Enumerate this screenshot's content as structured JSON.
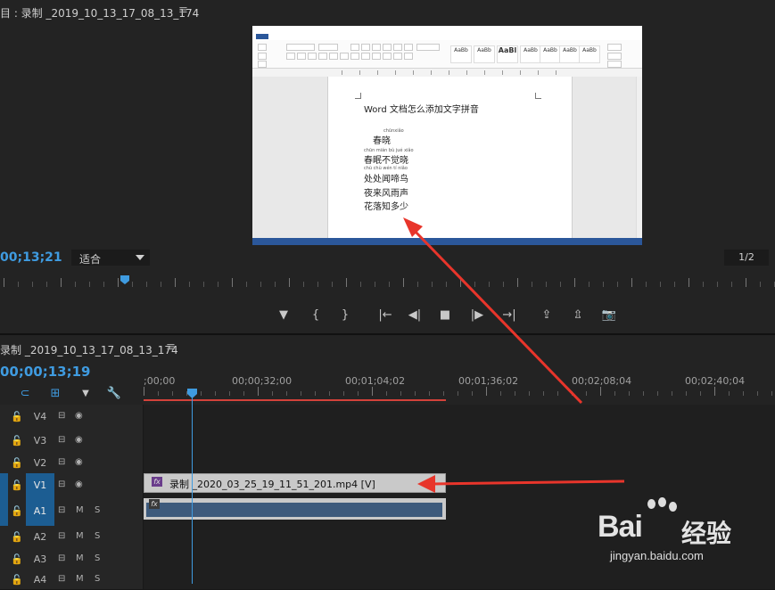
{
  "program_monitor": {
    "title": "目 : 录制 _2019_10_13_17_08_13_174",
    "menu_icon": "≡",
    "timecode": "00;13;21",
    "fit_select": "适合",
    "page_indicator": "1/2",
    "transport_buttons": [
      {
        "name": "add-marker-icon",
        "glyph": "▼"
      },
      {
        "name": "mark-in-icon",
        "glyph": "{"
      },
      {
        "name": "mark-out-icon",
        "glyph": "}"
      },
      {
        "name": "go-to-in-icon",
        "glyph": "|←"
      },
      {
        "name": "step-back-icon",
        "glyph": "◀|"
      },
      {
        "name": "stop-icon",
        "glyph": "■"
      },
      {
        "name": "step-forward-icon",
        "glyph": "|▶"
      },
      {
        "name": "go-to-out-icon",
        "glyph": "→|"
      },
      {
        "name": "lift-icon",
        "glyph": "⇪"
      },
      {
        "name": "extract-icon",
        "glyph": "⇫"
      },
      {
        "name": "export-frame-icon",
        "glyph": "📷"
      }
    ],
    "video_content": {
      "heading": "Word 文档怎么添加文字拼音",
      "poem_title_pinyin": "chūnxiǎo",
      "poem_title": "春晓",
      "lines": [
        {
          "pinyin": "chūn mián bù jué xiǎo",
          "text": "春眠不觉晓"
        },
        {
          "pinyin": "chù chù wén tí niǎo",
          "text": "处处闻啼鸟"
        },
        {
          "pinyin": "",
          "text": "夜来风雨声"
        },
        {
          "pinyin": "",
          "text": "花落知多少"
        }
      ]
    }
  },
  "timeline": {
    "title": "录制 _2019_10_13_17_08_13_174",
    "menu_icon": "≡",
    "timecode": "00;00;13;19",
    "tools": [
      {
        "name": "snap-icon",
        "glyph": "⊂"
      },
      {
        "name": "linked-selection-icon",
        "glyph": "⊞"
      },
      {
        "name": "add-marker-icon",
        "glyph": "▼"
      },
      {
        "name": "settings-wrench-icon",
        "glyph": "🔧"
      }
    ],
    "ruler_labels": [
      ";00;00",
      "00;00;32;00",
      "00;01;04;02",
      "00;01;36;02",
      "00;02;08;04",
      "00;02;40;04"
    ],
    "tracks": [
      {
        "name": "V4",
        "kind": "video",
        "targeted": false
      },
      {
        "name": "V3",
        "kind": "video",
        "targeted": false
      },
      {
        "name": "V2",
        "kind": "video",
        "targeted": false
      },
      {
        "name": "V1",
        "kind": "video",
        "targeted": true
      },
      {
        "name": "A1",
        "kind": "audio",
        "targeted": true
      },
      {
        "name": "A2",
        "kind": "audio",
        "targeted": false
      },
      {
        "name": "A3",
        "kind": "audio",
        "targeted": false
      },
      {
        "name": "A4",
        "kind": "audio",
        "targeted": false
      }
    ],
    "audio_track_buttons": {
      "mute": "M",
      "solo": "S"
    },
    "video_clip": {
      "label": "录制 _2020_03_25_19_11_51_201.mp4 [V]",
      "fx": "fx"
    },
    "audio_clip": {
      "fx": "fx"
    }
  },
  "watermark": {
    "brand": "Bai",
    "brand_cn": "经验",
    "url": "jingyan.baidu.com"
  },
  "colors": {
    "accent_blue": "#3f9be0",
    "arrow_red": "#e8352b",
    "panel_bg": "#232323"
  }
}
